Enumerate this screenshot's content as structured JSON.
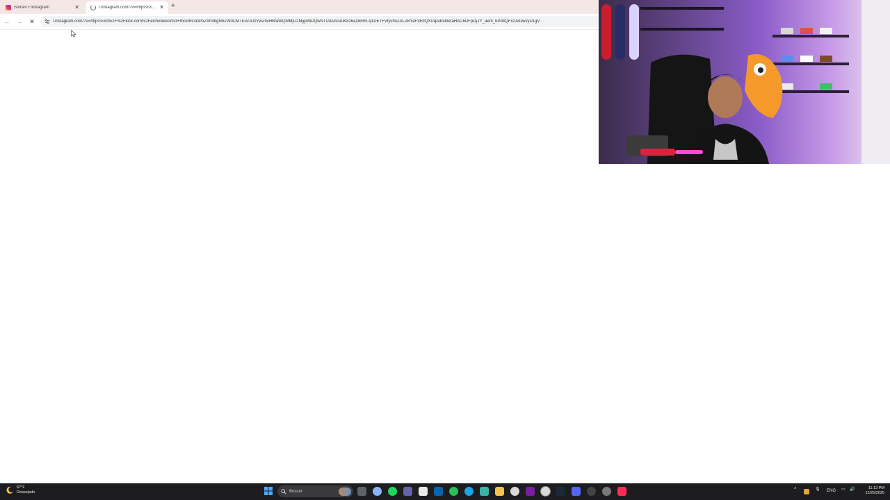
{
  "browser": {
    "tabs": [
      {
        "title": "Stories • Instagram",
        "icon": "instagram-icon",
        "active": false
      },
      {
        "title": "l.instagram.com/?u=https%3A%",
        "icon": "loading-spinner-icon",
        "active": true
      }
    ],
    "address_bar": {
      "url": "l.instagram.com/?u=https%3A%2F%2Fkick.com%2Felchiclekick%3Ffbclid%3DPAZXh0bgNhZW0CMTEAc3J0YwZhcHBfaWQMMjU2MjgxMDQwNTU4AAGruK826aOkRm-q1DETFVfyvmiZALZBYaF3E9QXUqAdrelbefaHAC6DFpDj-rY_aem_bPd4QFxzJvOwvyU1gV"
    },
    "new_tab_symbol": "+"
  },
  "taskbar": {
    "weather": {
      "temp": "67°F",
      "condition": "Despejado"
    },
    "search_placeholder": "Buscar",
    "language": "ENG",
    "time": "11:13 PM",
    "date": "12/25/2025"
  },
  "colors": {
    "tabstrip_bg": "#f6e7e7",
    "taskbar_bg": "#1d1d1f",
    "page_bg": "#ffffff"
  }
}
